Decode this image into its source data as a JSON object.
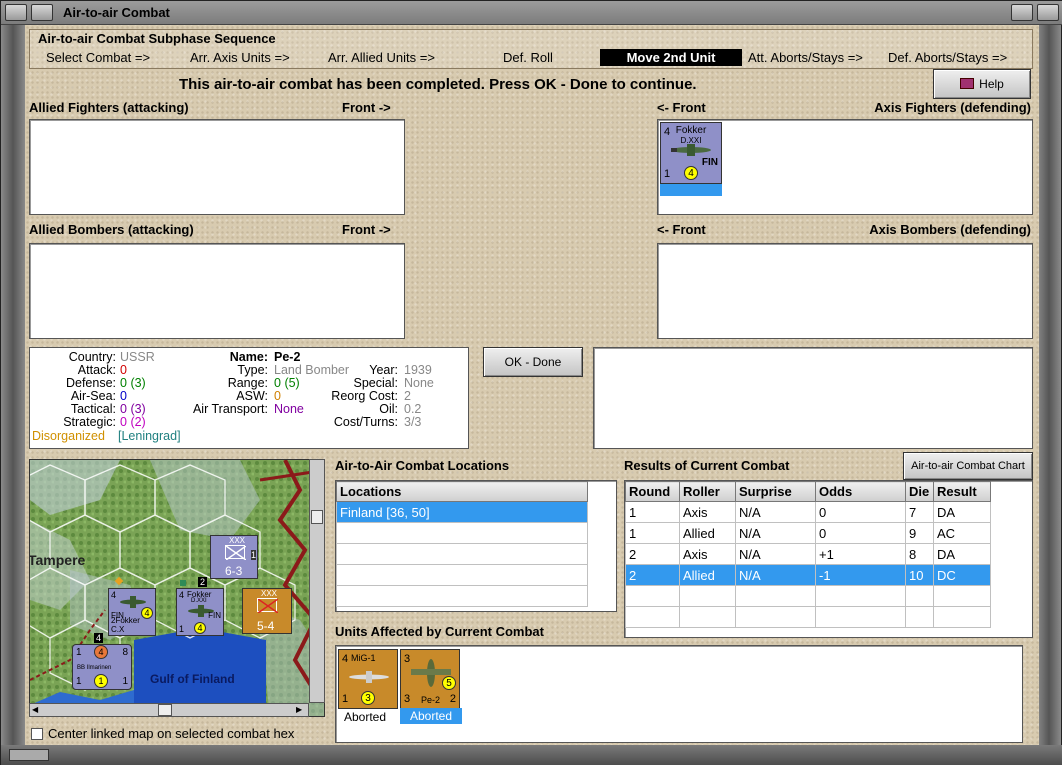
{
  "window": {
    "title": "Air-to-air Combat"
  },
  "sequence": {
    "title": "Air-to-air Combat Subphase Sequence",
    "steps": [
      "Select Combat =>",
      "Arr. Axis Units =>",
      "Arr. Allied Units =>",
      "Def. Roll",
      "Move 2nd Unit",
      "Att. Aborts/Stays =>",
      "Def. Aborts/Stays =>"
    ],
    "active_index": 4
  },
  "message": "This air-to-air combat has been completed.  Press OK - Done to continue.",
  "help_label": "Help",
  "panels": {
    "allied_fighters": "Allied Fighters (attacking)",
    "allied_fighters_front": "Front ->",
    "axis_fighters": "Axis Fighters (defending)",
    "axis_fighters_front": "<- Front",
    "allied_bombers": "Allied Bombers (attacking)",
    "allied_bombers_front": "Front ->",
    "axis_bombers": "Axis Bombers (defending)",
    "axis_bombers_front": "<- Front"
  },
  "axis_fighter_unit": {
    "name": "Fokker",
    "model": "D.XXI",
    "nation": "FIN",
    "attack": "4",
    "range": "1",
    "move": "4"
  },
  "ok_done_label": "OK - Done",
  "unit_info": {
    "country_label": "Country:",
    "country": "USSR",
    "attack_label": "Attack:",
    "attack": "0",
    "defense_label": "Defense:",
    "defense": "0",
    "defense_paren": "(3)",
    "airsea_label": "Air-Sea:",
    "airsea": "0",
    "tactical_label": "Tactical:",
    "tactical": "0",
    "tactical_paren": "(3)",
    "strategic_label": "Strategic:",
    "strategic": "0",
    "strategic_paren": "(2)",
    "status": "Disorganized",
    "location": "[Leningrad]",
    "name_label": "Name:",
    "name": "Pe-2",
    "type_label": "Type:",
    "type": "Land Bomber",
    "year_label": "Year:",
    "year": "1939",
    "range_label": "Range:",
    "range": "0",
    "range_paren": "(5)",
    "special_label": "Special:",
    "special": "None",
    "asw_label": "ASW:",
    "asw": "0",
    "reorg_label": "Reorg Cost:",
    "reorg": "2",
    "airtransport_label": "Air Transport:",
    "airtransport": "None",
    "oil_label": "Oil:",
    "oil": "0.2",
    "costturns_label": "Cost/Turns:",
    "costturns": "3/3"
  },
  "map": {
    "city": "Tampere",
    "sea": "Gulf of Finland",
    "unit1": {
      "name": "Fokker C.X",
      "nation": "FIN",
      "top": "4",
      "a": "2",
      "m": "4"
    },
    "unit2": {
      "name": "Fokker",
      "model": "D.XXI",
      "nation": "FIN",
      "top": "4",
      "a": "1",
      "m": "4",
      "stack": "2"
    },
    "corps1": {
      "label": "XXX",
      "value": "6-3",
      "tag": "1"
    },
    "corps2": {
      "label": "XXX",
      "value": "5-4"
    },
    "unit3": {
      "top": "4",
      "a": "1",
      "b": "8",
      "m": "1",
      "n": "4",
      "name": "BB Ilmarinen"
    },
    "checkbox_label": "Center linked map on selected combat hex"
  },
  "locations": {
    "title": "Air-to-Air Combat Locations",
    "header": "Locations",
    "rows": [
      "Finland [36, 50]"
    ]
  },
  "results": {
    "title": "Results of Current Combat",
    "chart_button": "Air-to-air Combat Chart",
    "headers": [
      "Round",
      "Roller",
      "Surprise",
      "Odds",
      "Die",
      "Result"
    ],
    "rows": [
      [
        "1",
        "Axis",
        "N/A",
        "0",
        "7",
        "DA"
      ],
      [
        "1",
        "Allied",
        "N/A",
        "0",
        "9",
        "AC"
      ],
      [
        "2",
        "Axis",
        "N/A",
        "+1",
        "8",
        "DA"
      ],
      [
        "2",
        "Allied",
        "N/A",
        "-1",
        "10",
        "DC"
      ]
    ],
    "selected_row": 3
  },
  "affected": {
    "title": "Units Affected by Current Combat",
    "units": [
      {
        "name": "MiG-1",
        "top": "4",
        "a": "1",
        "m": "3",
        "status": "Aborted"
      },
      {
        "name": "Pe-2",
        "top": "3",
        "a": "3",
        "b": "2",
        "m": "5",
        "status": "Aborted"
      }
    ]
  },
  "colors": {
    "axis_unit": "#8f90c8",
    "allied_unit": "#c88a2a",
    "selection": "#3399ee"
  }
}
